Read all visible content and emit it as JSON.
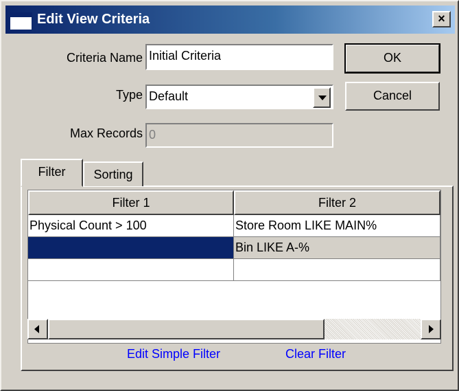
{
  "window": {
    "title": "Edit View Criteria",
    "close_glyph": "×"
  },
  "fields": {
    "criteria_name_label": "Criteria Name",
    "criteria_name_value": "Initial Criteria",
    "type_label": "Type",
    "type_value": "Default",
    "max_records_label": "Max Records",
    "max_records_value": "0"
  },
  "buttons": {
    "ok": "OK",
    "cancel": "Cancel"
  },
  "tabs": [
    {
      "label": "Filter",
      "active": true
    },
    {
      "label": "Sorting",
      "active": false
    }
  ],
  "grid": {
    "columns": [
      "Filter 1",
      "Filter 2"
    ],
    "rows": [
      [
        "Physical Count > 100",
        "Store Room LIKE MAIN%"
      ],
      [
        "",
        "Bin LIKE A-%"
      ],
      [
        "",
        ""
      ]
    ],
    "selected_row": 1,
    "selection_color": "#0a246a"
  },
  "links": {
    "edit_simple_filter": "Edit Simple Filter",
    "clear_filter": "Clear Filter"
  },
  "colors": {
    "title_bar": "#0a246a",
    "face": "#d4d0c8",
    "link": "#0000ff"
  }
}
